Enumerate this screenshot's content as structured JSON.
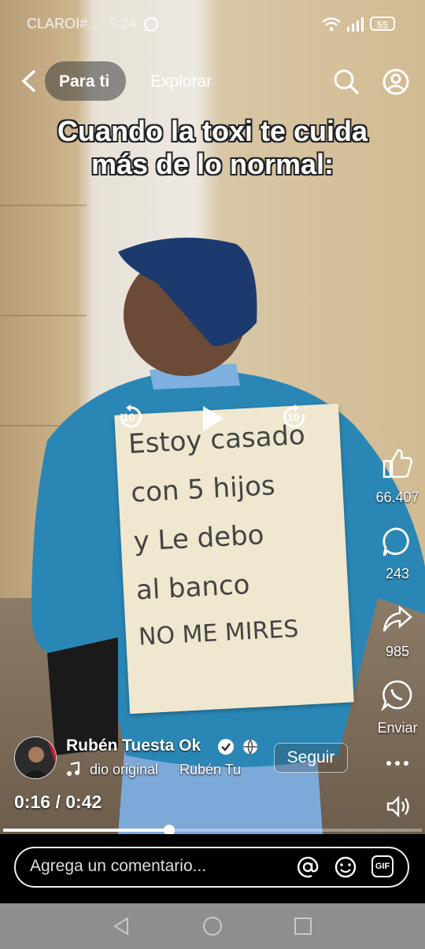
{
  "status_bar": {
    "carrier": "CLAROI#...",
    "time": "5:24",
    "battery": "55"
  },
  "top_nav": {
    "tab_for_you": "Para ti",
    "tab_explore": "Explorar"
  },
  "video": {
    "caption_line1": "Cuando la toxi te cuida",
    "caption_line2": "más de lo normal:",
    "sign_lines": [
      "Estoy casado",
      "con 5 hijos",
      "y Le debo",
      "al banco",
      "NO ME MIRES"
    ],
    "rewind_label": "10",
    "forward_label": "10"
  },
  "actions": {
    "likes": "66.407",
    "comments": "243",
    "shares": "985",
    "send_label": "Enviar"
  },
  "author": {
    "name": "Rubén Tuesta Ok",
    "audio": "dio original",
    "audio_author": "Rubén Tu",
    "follow_label": "Seguir"
  },
  "playback": {
    "current": "0:16",
    "separator": "/",
    "total": "0:42",
    "progress": 0.397
  },
  "comment": {
    "placeholder": "Agrega un comentario...",
    "gif_label": "GIF"
  },
  "colors": {
    "accent": "#ffffff",
    "sweater": "#2a87b5",
    "cap": "#1c3a6e"
  }
}
